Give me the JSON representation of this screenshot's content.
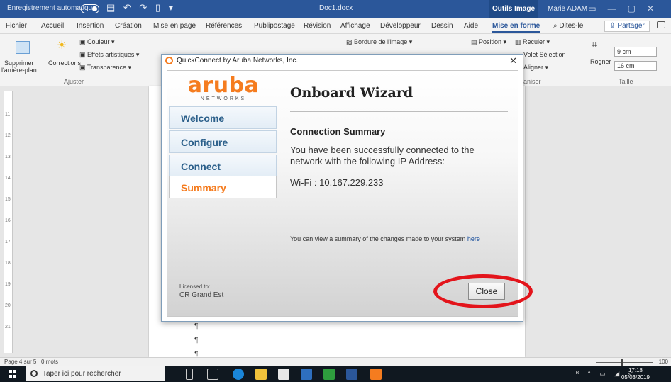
{
  "window": {
    "autosave_label": "Enregistrement automatique",
    "doc_title": "Doc1.docx",
    "contextual_tab": "Outils Image",
    "user": "Marie ADAM"
  },
  "tabs": [
    "Fichier",
    "Accueil",
    "Insertion",
    "Création",
    "Mise en page",
    "Références",
    "Publipostage",
    "Révision",
    "Affichage",
    "Développeur",
    "Dessin",
    "Aide",
    "Mise en forme",
    "Dites-le"
  ],
  "active_tab": "Mise en forme",
  "share_label": "Partager",
  "ribbon": {
    "remove_bg_1": "Supprimer",
    "remove_bg_2": "l'arrière-plan",
    "corrections": "Corrections",
    "color": "Couleur",
    "artistic": "Effets artistiques",
    "transparency": "Transparence",
    "group_adjust": "Ajuster",
    "border": "Bordure de l'image",
    "position": "Position",
    "send_back": "Reculer",
    "selection_pane": "Volet Sélection",
    "align": "Aligner",
    "group_arrange": "aniser",
    "crop": "Rogner",
    "height": "9 cm",
    "width": "16 cm",
    "group_size": "Taille"
  },
  "statusbar": {
    "page": "Page 4 sur 5",
    "words": "0 mots",
    "zoom": "100"
  },
  "taskbar": {
    "search_placeholder": "Taper ici pour rechercher",
    "time": "17:18",
    "date": "05/03/2019"
  },
  "dialog": {
    "title": "QuickConnect by Aruba Networks, Inc.",
    "logo_word": "aruba",
    "logo_sub": "NETWORKS",
    "nav": [
      "Welcome",
      "Configure",
      "Connect",
      "Summary"
    ],
    "active_nav": "Summary",
    "heading": "Onboard Wizard",
    "section_title": "Connection Summary",
    "message": "You have been successfully connected to the network with the following IP Address:",
    "ip_line": "Wi-Fi : 10.167.229.233",
    "view_summary_text": "You can view a summary of the changes made to your system",
    "view_summary_link": "here",
    "licensed_to": "Licensed to:",
    "licensee": "CR Grand Est",
    "close_label": "Close"
  },
  "colors": {
    "word_blue": "#2b579a",
    "aruba_orange": "#f57c1f",
    "highlight_red": "#e3141b"
  }
}
